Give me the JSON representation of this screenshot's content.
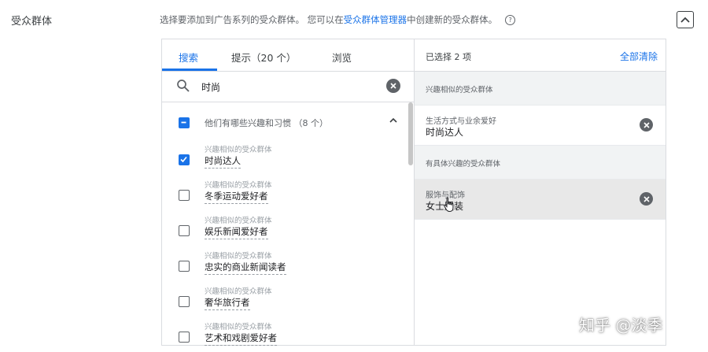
{
  "section": {
    "label": "受众群体",
    "desc_before": "选择要添加到广告系列的受众群体。 您可以在",
    "desc_link": "受众群体管理器",
    "desc_after": "中创建新的受众群体。",
    "help_icon": "?"
  },
  "tabs": [
    {
      "label": "搜索",
      "active": true
    },
    {
      "label": "提示（20 个）",
      "active": false
    },
    {
      "label": "浏览",
      "active": false
    }
  ],
  "search": {
    "value": "时尚"
  },
  "group": {
    "label": "他们有哪些兴趣和习惯 （8 个）",
    "state": "partial"
  },
  "results": [
    {
      "category": "兴趣相似的受众群体",
      "name": "时尚达人",
      "checked": true
    },
    {
      "category": "兴趣相似的受众群体",
      "name": "冬季运动爱好者",
      "checked": false
    },
    {
      "category": "兴趣相似的受众群体",
      "name": "娱乐新闻爱好者",
      "checked": false
    },
    {
      "category": "兴趣相似的受众群体",
      "name": "忠实的商业新闻读者",
      "checked": false
    },
    {
      "category": "兴趣相似的受众群体",
      "name": "奢华旅行者",
      "checked": false
    },
    {
      "category": "兴趣相似的受众群体",
      "name": "艺术和戏剧爱好者",
      "checked": false
    }
  ],
  "selected": {
    "title": "已选择 2 项",
    "clear_all": "全部清除",
    "categories": [
      {
        "label": "兴趣相似的受众群体",
        "items": [
          {
            "sub": "生活方式与业余爱好",
            "main": "时尚达人"
          }
        ]
      },
      {
        "label": "有具体兴趣的受众群体",
        "items": [
          {
            "sub": "服饰与配饰",
            "main": "女士服装"
          }
        ]
      }
    ]
  },
  "watermark": "知乎 @淡季",
  "colors": {
    "accent": "#1a73e8",
    "hover_row": "#e8e8e8",
    "category_bg": "#f1f3f4"
  },
  "icons": [
    "chevron-up-icon",
    "search-icon",
    "clear-icon",
    "checkbox-icon",
    "remove-icon",
    "hand-cursor-icon"
  ]
}
